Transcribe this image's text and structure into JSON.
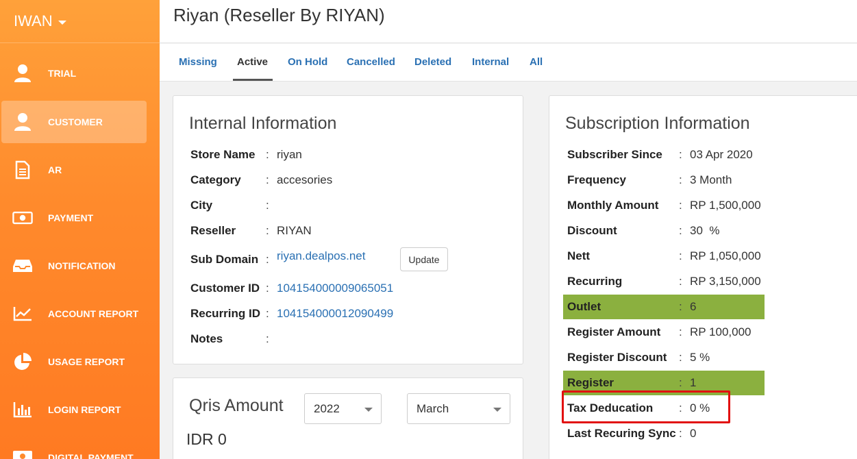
{
  "sidebar": {
    "brand": "IWAN",
    "items": [
      {
        "label": "TRIAL",
        "icon": "user-icon"
      },
      {
        "label": "CUSTOMER",
        "icon": "user-icon"
      },
      {
        "label": "AR",
        "icon": "document-icon"
      },
      {
        "label": "PAYMENT",
        "icon": "money-icon"
      },
      {
        "label": "NOTIFICATION",
        "icon": "inbox-icon"
      },
      {
        "label": "ACCOUNT REPORT",
        "icon": "line-chart-icon"
      },
      {
        "label": "USAGE REPORT",
        "icon": "pie-chart-icon"
      },
      {
        "label": "LOGIN REPORT",
        "icon": "bar-chart-icon"
      },
      {
        "label": "DIGITAL PAYMENT",
        "icon": "card-icon"
      }
    ],
    "active_index": 1
  },
  "header": {
    "title": "Riyan (Reseller By RIYAN)"
  },
  "tabs": [
    "Missing",
    "Active",
    "On Hold",
    "Cancelled",
    "Deleted",
    "Internal",
    "All"
  ],
  "active_tab": "Active",
  "internal": {
    "title": "Internal Information",
    "store_name_label": "Store Name",
    "store_name": "riyan",
    "category_label": "Category",
    "category": "accesories",
    "city_label": "City",
    "city": "",
    "reseller_label": "Reseller",
    "reseller": "RIYAN",
    "subdomain_label": "Sub Domain",
    "subdomain": "riyan.dealpos.net",
    "update_label": "Update",
    "customer_id_label": "Customer ID",
    "customer_id": "104154000009065051",
    "recurring_id_label": "Recurring ID",
    "recurring_id": "104154000012090499",
    "notes_label": "Notes",
    "notes": ""
  },
  "qris": {
    "title": "Qris Amount",
    "year": "2022",
    "month": "March",
    "amount": "IDR 0"
  },
  "subscription": {
    "title": "Subscription Information",
    "rows": [
      {
        "label": "Subscriber Since",
        "value": "03 Apr 2020"
      },
      {
        "label": "Frequency",
        "value": "3 Month"
      },
      {
        "label": "Monthly Amount",
        "value": "RP 1,500,000"
      },
      {
        "label": "Discount",
        "value": "30  %"
      },
      {
        "label": "Nett",
        "value": "RP 1,050,000"
      },
      {
        "label": "Recurring",
        "value": "RP 3,150,000"
      },
      {
        "label": "Outlet",
        "value": "6"
      },
      {
        "label": "Register Amount",
        "value": "RP 100,000"
      },
      {
        "label": "Register Discount",
        "value": "5 %"
      },
      {
        "label": "Register",
        "value": "1"
      },
      {
        "label": "Tax Deducation",
        "value": "0 %"
      },
      {
        "label": "Last Recuring Sync",
        "value": "0"
      }
    ],
    "highlight_color": "#8bb03f",
    "annotation_color": "#e20f0f"
  },
  "colors": {
    "accent": "#ff8a2c",
    "link": "#2a70b3"
  }
}
